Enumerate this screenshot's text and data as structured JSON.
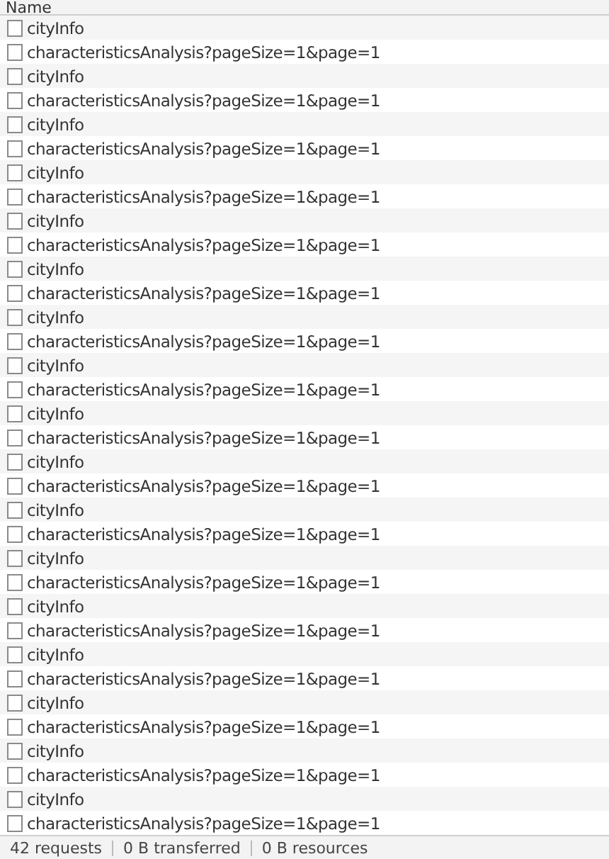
{
  "table": {
    "columns": [
      "Name"
    ],
    "rows": [
      "cityInfo",
      "characteristicsAnalysis?pageSize=1&page=1",
      "cityInfo",
      "characteristicsAnalysis?pageSize=1&page=1",
      "cityInfo",
      "characteristicsAnalysis?pageSize=1&page=1",
      "cityInfo",
      "characteristicsAnalysis?pageSize=1&page=1",
      "cityInfo",
      "characteristicsAnalysis?pageSize=1&page=1",
      "cityInfo",
      "characteristicsAnalysis?pageSize=1&page=1",
      "cityInfo",
      "characteristicsAnalysis?pageSize=1&page=1",
      "cityInfo",
      "characteristicsAnalysis?pageSize=1&page=1",
      "cityInfo",
      "characteristicsAnalysis?pageSize=1&page=1",
      "cityInfo",
      "characteristicsAnalysis?pageSize=1&page=1",
      "cityInfo",
      "characteristicsAnalysis?pageSize=1&page=1",
      "cityInfo",
      "characteristicsAnalysis?pageSize=1&page=1",
      "cityInfo",
      "characteristicsAnalysis?pageSize=1&page=1",
      "cityInfo",
      "characteristicsAnalysis?pageSize=1&page=1",
      "cityInfo",
      "characteristicsAnalysis?pageSize=1&page=1",
      "cityInfo",
      "characteristicsAnalysis?pageSize=1&page=1",
      "cityInfo",
      "characteristicsAnalysis?pageSize=1&page=1"
    ]
  },
  "status_bar": [
    "42 requests",
    "0 B transferred",
    "0 B resources"
  ]
}
